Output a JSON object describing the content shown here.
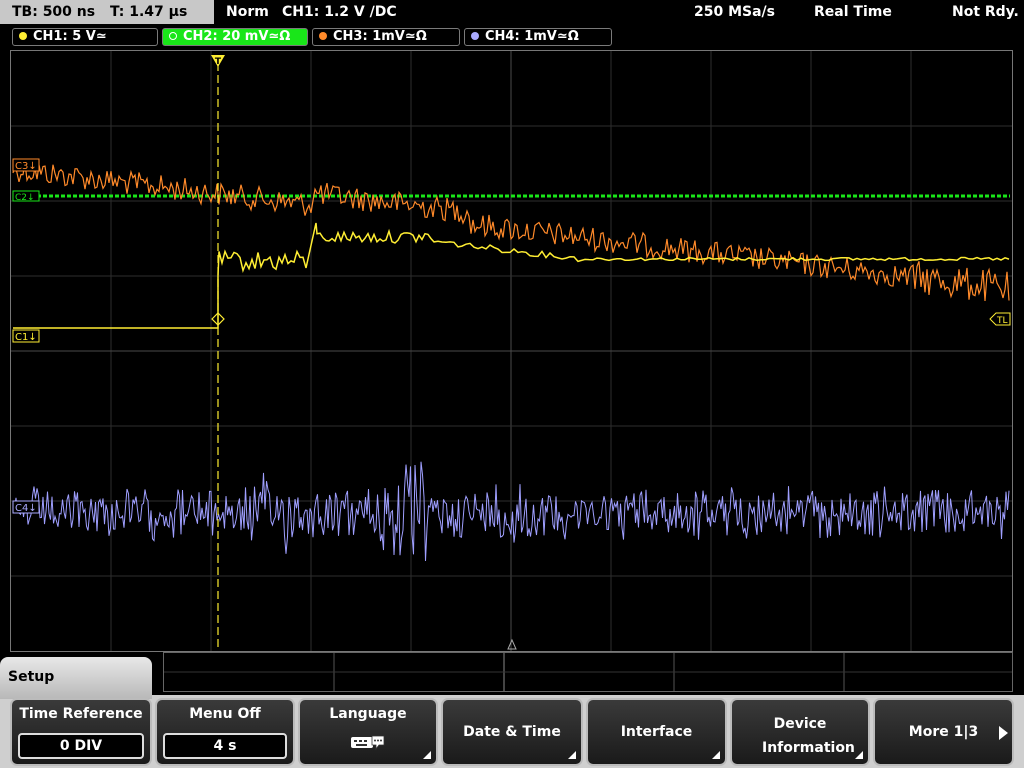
{
  "status": {
    "timebase": "TB: 500 ns",
    "trigger_time": "T: 1.47 µs",
    "mode": "Norm",
    "trigger": "CH1: 1.2 V ∕DC",
    "sample_rate": "250 MSa/s",
    "acq_mode": "Real Time",
    "state": "Not Rdy."
  },
  "channels": [
    {
      "label": "CH1: 5 V≃",
      "color": "#ffee33"
    },
    {
      "label": "CH2: 20 mV≃Ω",
      "color": "#19e619"
    },
    {
      "label": "CH3: 1mV≃Ω",
      "color": "#ff8a2a"
    },
    {
      "label": "CH4: 1mV≃Ω",
      "color": "#aaaaff"
    }
  ],
  "markers": {
    "ch1_ref": "C1↓",
    "ch3_ref": "C3↓",
    "ch2_ref": "C2↓",
    "ch4_ref": "C4↓",
    "trigger_level": "TL",
    "trigger_pos": "T"
  },
  "menu": {
    "title": "Setup",
    "softkeys": [
      {
        "label": "Time Reference",
        "value": "0 DIV"
      },
      {
        "label": "Menu Off",
        "value": "4 s"
      },
      {
        "label": "Language",
        "icon": "keyboard-icon"
      },
      {
        "label": "Date & Time"
      },
      {
        "label": "Interface"
      },
      {
        "label": "Device Information"
      },
      {
        "label": "More 1|3"
      }
    ]
  }
}
